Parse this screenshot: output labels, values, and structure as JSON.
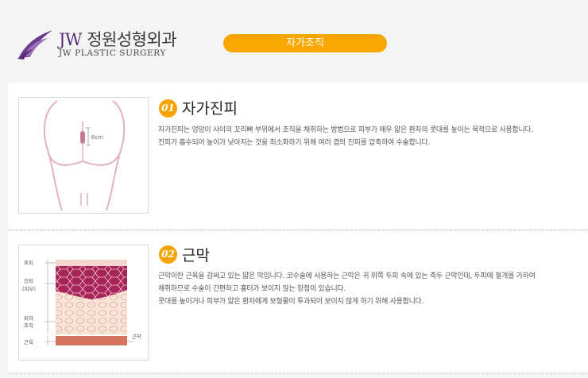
{
  "header": {
    "logo_brand": "JW",
    "logo_name": "정원성형외과",
    "logo_sub": "JW PLASTIC SURGERY",
    "page_button": "자가조직"
  },
  "sections": [
    {
      "number": "01",
      "title": "자가진피",
      "lines": [
        "자가진피는 엉덩이 사이의 꼬리뼈 부위에서 조직을 채취하는 방법으로 피부가 매우 얇은 환자의 콧대를 높이는 목적으로 사용합니다.",
        "진피가 흡수되어 높이가 낮아지는 것을 최소화하기 위해 여러 겹의 진피를 압축하여 수술합니다."
      ],
      "figure": {
        "measure_label": "6cm"
      }
    },
    {
      "number": "02",
      "title": "근막",
      "lines": [
        "근막이란 근육을 감싸고 있는 얇은 막입니다. 코수술에 사용하는 근막은 귀 위쪽 두피 속에 있는 측두 근막인데, 두피에 절개를 가하여",
        "채취하므로 수술이 간편하고 흉터가 보이지 않는 장점이 있습니다.",
        "콧대를 높이거나 피부가 얇은 환자에게 보형물이 투과되어 보이지 않게 하기 위해 사용합니다."
      ],
      "figure": {
        "labels": {
          "epidermis": "표피",
          "dermis_1": "진피",
          "dermis_2": "(피부)",
          "subcutaneous_1": "피하",
          "subcutaneous_2": "조직",
          "fascia": "근육",
          "fascia_right": "근막"
        }
      }
    }
  ],
  "colors": {
    "accent": "#f7a700",
    "brand_purple": "#5a2e7e",
    "figure_pink": "#d88aa0"
  }
}
